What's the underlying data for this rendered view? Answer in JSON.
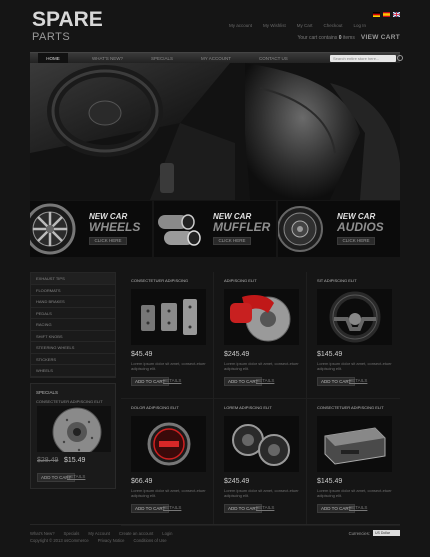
{
  "logo": {
    "line1": "SPARE",
    "line2": "PARTS"
  },
  "top_links": [
    "My account",
    "My Wishlist",
    "My Cart",
    "Checkout",
    "Log In"
  ],
  "flags": [
    {
      "name": "de-flag"
    },
    {
      "name": "es-flag"
    },
    {
      "name": "gb-flag"
    }
  ],
  "cart": {
    "prefix": "Your cart contains",
    "count": "0",
    "suffix": "items",
    "view": "VIEW CART"
  },
  "nav": [
    {
      "label": "HOME"
    },
    {
      "label": "WHAT'S NEW?"
    },
    {
      "label": "SPECIALS"
    },
    {
      "label": "MY ACCOUNT"
    },
    {
      "label": "CONTACT US"
    }
  ],
  "search": {
    "placeholder": "Search entire store here..."
  },
  "banners": [
    {
      "t1": "NEW CAR",
      "t2": "WHEELS",
      "btn": "CLICK HERE",
      "icon": "wheel-icon"
    },
    {
      "t1": "NEW CAR",
      "t2": "MUFFLER",
      "btn": "CLICK HERE",
      "icon": "muffler-icon"
    },
    {
      "t1": "NEW CAR",
      "t2": "AUDIOS",
      "btn": "CLICK HERE",
      "icon": "speaker-icon"
    }
  ],
  "categories": [
    "EXHAUST TIPS",
    "FLOORMATS",
    "HAND BRAKES",
    "PEDALS",
    "RACING",
    "SHIFT KNOBS",
    "STEERING WHEELS",
    "STICKERS",
    "WHEELS"
  ],
  "specials": {
    "heading": "SPECIALS",
    "name": "CONSECTETUER ADIPISCING ELIT",
    "old_price": "$28.49",
    "new_price": "$15.49",
    "add": "ADD TO CART",
    "details": "DETAILS"
  },
  "products": [
    {
      "name": "CONSECTETUER ADIPISCING",
      "price": "$45.49",
      "desc": "Lorem ipsum dolor sit amet, consect-etuer adipiscing elit.",
      "add": "ADD TO CART",
      "details": "DETAILS"
    },
    {
      "name": "ADIPISCING ELIT",
      "price": "$245.49",
      "desc": "Lorem ipsum dolor sit amet, consect-etuer adipiscing elit.",
      "add": "ADD TO CART",
      "details": "DETAILS"
    },
    {
      "name": "SIT ADIPISCING ELIT",
      "price": "$145.49",
      "desc": "Lorem ipsum dolor sit amet, consect-etuer adipiscing elit.",
      "add": "ADD TO CART",
      "details": "DETAILS"
    },
    {
      "name": "DOLOR ADIPISCING ELIT",
      "price": "$66.49",
      "desc": "Lorem ipsum dolor sit amet, consect-etuer adipiscing elit.",
      "add": "ADD TO CART",
      "details": "DETAILS"
    },
    {
      "name": "LOREM ADIPISCING ELIT",
      "price": "$245.49",
      "desc": "Lorem ipsum dolor sit amet, consect-etuer adipiscing elit.",
      "add": "ADD TO CART",
      "details": "DETAILS"
    },
    {
      "name": "CONSECTETUER ADIPISCING ELIT",
      "price": "$145.49",
      "desc": "Lorem ipsum dolor sit amet, consect-etuer adipiscing elit.",
      "add": "ADD TO CART",
      "details": "DETAILS"
    }
  ],
  "footer": {
    "links1": [
      "What's New?",
      "Specials",
      "My Account",
      "Create an account",
      "Login"
    ],
    "links2": [
      "Copyright © 2013 osCommerce",
      "Privacy Notice",
      "Conditions of Use"
    ],
    "currencies_label": "Currencies:",
    "currency_selected": "US Dollar"
  }
}
